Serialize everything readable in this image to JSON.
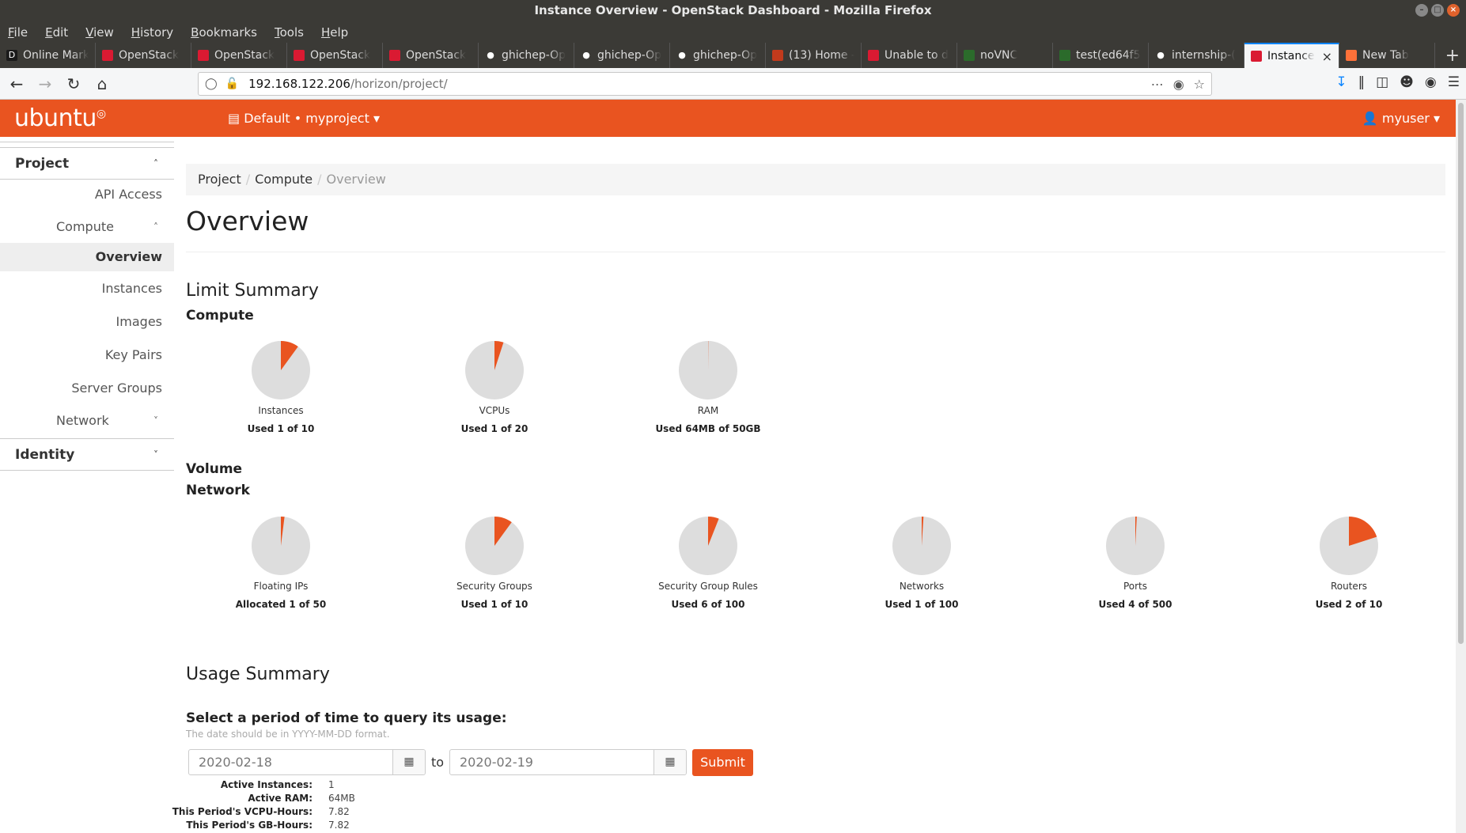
{
  "window": {
    "title": "Instance Overview - OpenStack Dashboard - Mozilla Firefox"
  },
  "menu": [
    "File",
    "Edit",
    "View",
    "History",
    "Bookmarks",
    "Tools",
    "Help"
  ],
  "tabs": [
    {
      "label": "Online Mark",
      "icon": "D",
      "color": "#1a1a1a"
    },
    {
      "label": "OpenStack",
      "icon": "",
      "color": "#da1a32"
    },
    {
      "label": "OpenStack",
      "icon": "",
      "color": "#da1a32"
    },
    {
      "label": "OpenStack",
      "icon": "",
      "color": "#da1a32"
    },
    {
      "label": "OpenStack",
      "icon": "",
      "color": "#da1a32"
    },
    {
      "label": "ghichep-Op",
      "icon": "●",
      "color": "#3b3a36"
    },
    {
      "label": "ghichep-Op",
      "icon": "●",
      "color": "#3b3a36"
    },
    {
      "label": "ghichep-Op",
      "icon": "●",
      "color": "#3b3a36"
    },
    {
      "label": "(13) Home -",
      "icon": "",
      "color": "#c23a1c"
    },
    {
      "label": "Unable to d",
      "icon": "",
      "color": "#da1a32"
    },
    {
      "label": "noVNC",
      "icon": "",
      "color": "#2b6b2b"
    },
    {
      "label": "test(ed64f5",
      "icon": "",
      "color": "#2b6b2b"
    },
    {
      "label": "internship-(",
      "icon": "●",
      "color": "#3b3a36"
    },
    {
      "label": "Instance",
      "icon": "",
      "color": "#da1a32",
      "active": true
    },
    {
      "label": "New Tab",
      "icon": "",
      "color": "#ff7139"
    }
  ],
  "url": {
    "host": "192.168.122.206",
    "path": "/horizon/project/"
  },
  "header": {
    "logo": "ubuntu",
    "project": "Default • myproject",
    "user": "myuser"
  },
  "sidebar": {
    "project": "Project",
    "api_access": "API Access",
    "compute": "Compute",
    "items": [
      "Overview",
      "Instances",
      "Images",
      "Key Pairs",
      "Server Groups"
    ],
    "network": "Network",
    "identity": "Identity"
  },
  "breadcrumb": {
    "a": "Project",
    "b": "Compute",
    "c": "Overview"
  },
  "page": {
    "title": "Overview"
  },
  "limit_summary": {
    "title": "Limit Summary",
    "compute_title": "Compute",
    "volume_title": "Volume",
    "network_title": "Network",
    "compute": [
      {
        "label": "Instances",
        "used": "Used 1 of 10",
        "fraction": 0.1
      },
      {
        "label": "VCPUs",
        "used": "Used 1 of 20",
        "fraction": 0.05
      },
      {
        "label": "RAM",
        "used": "Used 64MB of 50GB",
        "fraction": 0.00125
      }
    ],
    "network": [
      {
        "label": "Floating IPs",
        "used": "Allocated 1 of 50",
        "fraction": 0.02
      },
      {
        "label": "Security Groups",
        "used": "Used 1 of 10",
        "fraction": 0.1
      },
      {
        "label": "Security Group Rules",
        "used": "Used 6 of 100",
        "fraction": 0.06
      },
      {
        "label": "Networks",
        "used": "Used 1 of 100",
        "fraction": 0.01
      },
      {
        "label": "Ports",
        "used": "Used 4 of 500",
        "fraction": 0.008
      },
      {
        "label": "Routers",
        "used": "Used 2 of 10",
        "fraction": 0.2
      }
    ],
    "colors": {
      "used": "#e95420",
      "free": "#dddddd"
    }
  },
  "usage_summary": {
    "title": "Usage Summary",
    "prompt": "Select a period of time to query its usage:",
    "hint": "The date should be in YYYY-MM-DD format.",
    "start": "2020-02-18",
    "end": "2020-02-19",
    "to": "to",
    "submit": "Submit",
    "stats": [
      {
        "k": "Active Instances:",
        "v": "1"
      },
      {
        "k": "Active RAM:",
        "v": "64MB"
      },
      {
        "k": "This Period's VCPU-Hours:",
        "v": "7.82"
      },
      {
        "k": "This Period's GB-Hours:",
        "v": "7.82"
      }
    ]
  }
}
